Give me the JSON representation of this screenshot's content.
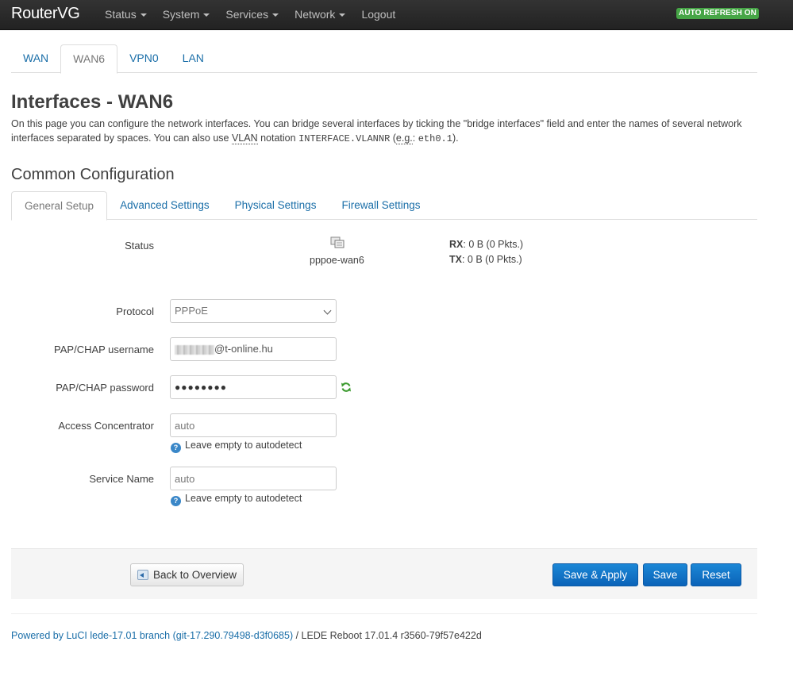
{
  "app": {
    "brand": "RouterVG",
    "menu": [
      {
        "label": "Status",
        "dropdown": true
      },
      {
        "label": "System",
        "dropdown": true
      },
      {
        "label": "Services",
        "dropdown": true
      },
      {
        "label": "Network",
        "dropdown": true
      },
      {
        "label": "Logout",
        "dropdown": false
      }
    ],
    "refresh_badge": "AUTO REFRESH ON",
    "refresh_badge_color": "#46a546"
  },
  "interface_tabs": [
    {
      "label": "WAN",
      "active": false
    },
    {
      "label": "WAN6",
      "active": true
    },
    {
      "label": "VPN0",
      "active": false
    },
    {
      "label": "LAN",
      "active": false
    }
  ],
  "page": {
    "title": "Interfaces - WAN6",
    "intro_part1": "On this page you can configure the network interfaces. You can bridge several interfaces by ticking the \"bridge interfaces\" field and enter the names of several network interfaces separated by spaces. You can also use ",
    "intro_vlan": "VLAN",
    "intro_part2": " notation ",
    "intro_code1": "INTERFACE.VLANNR",
    "intro_part3": " (",
    "intro_eg": "e.g.",
    "intro_part4": ": ",
    "intro_code2": "eth0.1",
    "intro_part5": ")."
  },
  "section": {
    "title": "Common Configuration",
    "tabs": [
      {
        "label": "General Setup",
        "active": true
      },
      {
        "label": "Advanced Settings",
        "active": false
      },
      {
        "label": "Physical Settings",
        "active": false
      },
      {
        "label": "Firewall Settings",
        "active": false
      }
    ]
  },
  "status": {
    "label": "Status",
    "icon": "network-device-icon",
    "interface_name": "pppoe-wan6",
    "rx_label": "RX",
    "rx_value": ": 0 B (0 Pkts.)",
    "tx_label": "TX",
    "tx_value": ": 0 B (0 Pkts.)"
  },
  "form": {
    "protocol_label": "Protocol",
    "protocol_value": "PPPoE",
    "username_label": "PAP/CHAP username",
    "username_value": "@t-online.hu",
    "password_label": "PAP/CHAP password",
    "password_value": "●●●●●●●●",
    "password_reveal_icon": "reload-icon",
    "ac_label": "Access Concentrator",
    "ac_placeholder": "auto",
    "ac_hint": "Leave empty to autodetect",
    "service_label": "Service Name",
    "service_placeholder": "auto",
    "service_hint": "Leave empty to autodetect"
  },
  "actions": {
    "back": "Back to Overview",
    "save_apply": "Save & Apply",
    "save": "Save",
    "reset": "Reset",
    "primary_color": "#0e6fc6"
  },
  "footer": {
    "link": "Powered by LuCI lede-17.01 branch (git-17.290.79498-d3f0685)",
    "text": " / LEDE Reboot 17.01.4 r3560-79f57e422d"
  }
}
